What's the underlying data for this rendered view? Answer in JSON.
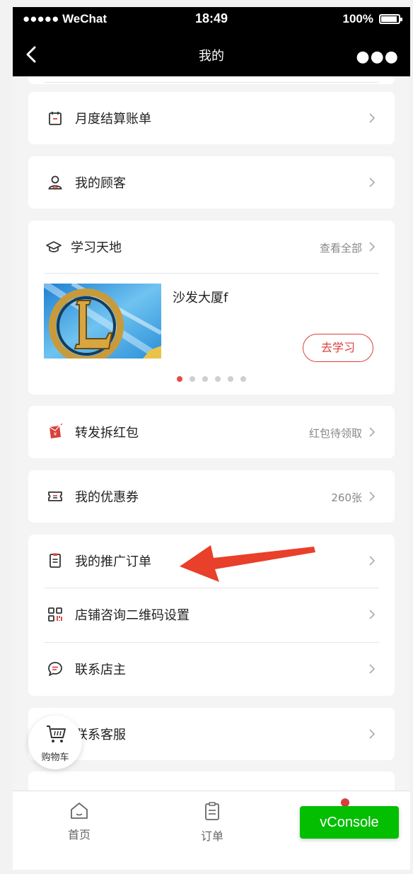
{
  "status": {
    "carrier": "●●●●● WeChat",
    "time": "18:49",
    "battery": "100%"
  },
  "nav": {
    "title": "我的",
    "more": "●●●"
  },
  "menu": {
    "monthly_bill": "月度结算账单",
    "my_customers": "我的顾客"
  },
  "study": {
    "title": "学习天地",
    "view_all": "查看全部",
    "course_title": "沙发大厦f",
    "learn_button": "去学习",
    "dots_total": 6,
    "dots_active": 1
  },
  "redpacket": {
    "label": "转发拆红包",
    "status": "红包待领取"
  },
  "coupons": {
    "label": "我的优惠券",
    "count": "260张"
  },
  "group": {
    "orders": "我的推广订单",
    "qrcode": "店铺咨询二维码设置",
    "contact_owner": "联系店主"
  },
  "service": {
    "label": "联系客服"
  },
  "cart": {
    "label": "购物车"
  },
  "tabbar": {
    "home": "首页",
    "orders": "订单"
  },
  "vconsole": {
    "label": "vConsole"
  },
  "colors": {
    "accent": "#d9403a",
    "vconsole": "#04be02",
    "arrow": "#e8402a"
  }
}
